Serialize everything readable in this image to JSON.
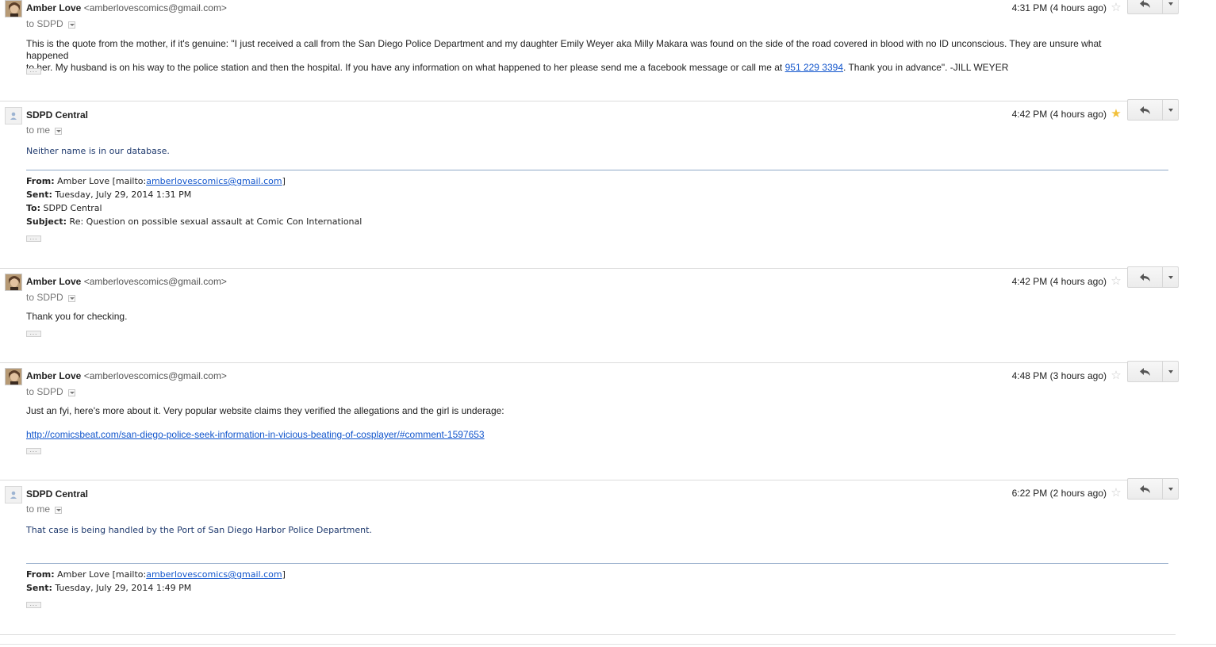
{
  "messages": [
    {
      "sender_name": "Amber Love",
      "sender_email": "<amberlovescomics@gmail.com>",
      "recipients": "to SDPD",
      "time": "4:31 PM (4 hours ago)",
      "starred": false,
      "body_line1": "This is the quote from the mother, if it's genuine: \"I just received a call from the San Diego Police Department and my daughter Emily Weyer aka Milly Makara was found on the side of the road covered in blood with no ID unconscious. They are unsure what happened",
      "body_line2_pre": "to her. My husband is on his way to the police station and then the hospital. If you have any information on what happened to her please send me a facebook message or call me at ",
      "phone": "951 229 3394",
      "body_line2_post": ". Thank you in advance\". -JILL WEYER"
    },
    {
      "sender_name": "SDPD Central",
      "recipients": "to me",
      "time": "4:42 PM (4 hours ago)",
      "starred": true,
      "body": "Neither name is in our database.",
      "quote": {
        "from_label": "From:",
        "from_pre": "Amber Love [mailto:",
        "from_link": "amberlovescomics@gmail.com",
        "from_post": "]",
        "sent_label": "Sent:",
        "sent": "Tuesday, July 29, 2014 1:31 PM",
        "to_label": "To:",
        "to": "SDPD Central",
        "subject_label": "Subject:",
        "subject": "Re: Question on possible sexual assault at Comic Con International"
      }
    },
    {
      "sender_name": "Amber Love",
      "sender_email": "<amberlovescomics@gmail.com>",
      "recipients": "to SDPD",
      "time": "4:42 PM (4 hours ago)",
      "starred": false,
      "body": "Thank you for checking."
    },
    {
      "sender_name": "Amber Love",
      "sender_email": "<amberlovescomics@gmail.com>",
      "recipients": "to SDPD",
      "time": "4:48 PM (3 hours ago)",
      "starred": false,
      "body": "Just an fyi, here's more about it. Very popular website claims they verified the allegations and the girl is underage:",
      "link": "http://comicsbeat.com/san-diego-police-seek-information-in-vicious-beating-of-cosplayer/#comment-1597653"
    },
    {
      "sender_name": "SDPD Central",
      "recipients": "to me",
      "time": "6:22 PM (2 hours ago)",
      "starred": false,
      "body": "That case is being handled by the Port of San Diego Harbor Police Department.",
      "quote": {
        "from_label": "From:",
        "from_pre": "Amber Love [mailto:",
        "from_link": "amberlovescomics@gmail.com",
        "from_post": "]",
        "sent_label": "Sent:",
        "sent": "Tuesday, July 29, 2014 1:49 PM"
      }
    }
  ],
  "ellipsis_label": "...",
  "icons": {
    "star": "star-icon",
    "reply": "reply-icon",
    "more": "chevron-down-icon",
    "avatar_photo": "user-photo-avatar",
    "avatar_generic": "person-icon"
  },
  "colors": {
    "link": "#1155cc",
    "sdpd_text": "#1f3a6e",
    "star_on": "#f2c03a",
    "star_off": "#c9c9c9"
  }
}
